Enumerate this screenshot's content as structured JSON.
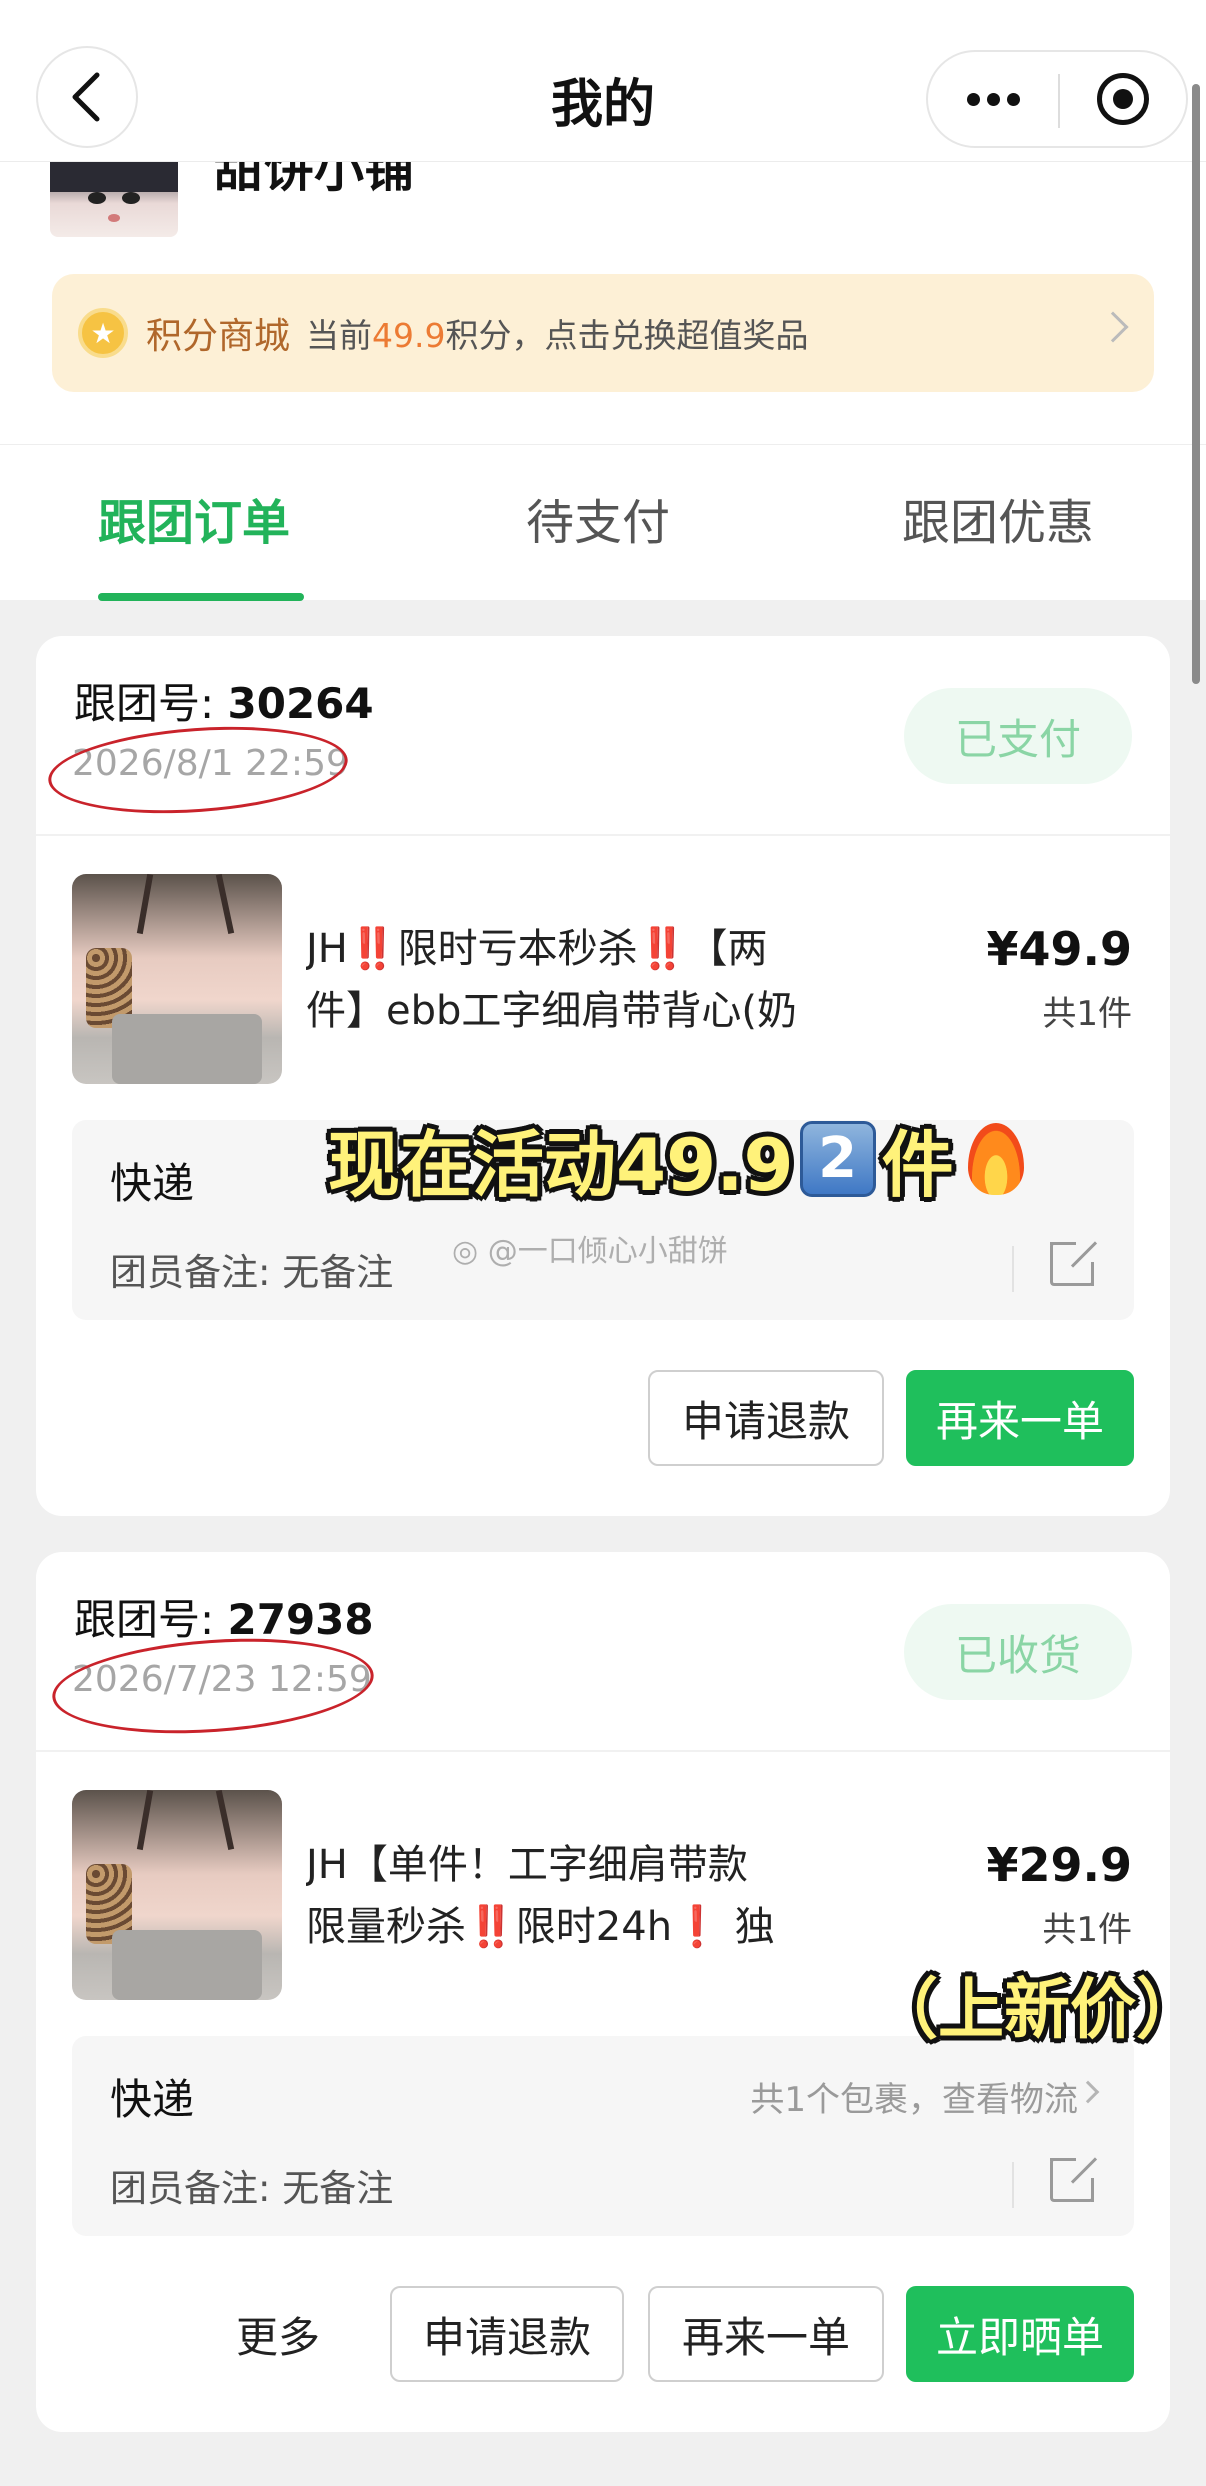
{
  "header": {
    "title": "我的"
  },
  "profile": {
    "shop_name": "甜饼小铺"
  },
  "points_banner": {
    "title": "积分商城",
    "desc_prefix": "当前",
    "points": "49.9",
    "desc_suffix": "积分，点击兑换超值奖品"
  },
  "tabs": [
    {
      "label": "跟团订单",
      "active": true
    },
    {
      "label": "待支付",
      "active": false
    },
    {
      "label": "跟团优惠",
      "active": false
    }
  ],
  "orders": [
    {
      "order_label": "跟团号: ",
      "order_number": "30264",
      "time": "2026/8/1 22:59",
      "status": "已支付",
      "title_line1_prefix": "JH",
      "title_line1_mark1": "‼️",
      "title_line1_mid": "限时亏本秒杀",
      "title_line1_mark2": "‼️",
      "title_line1_suffix": "【两",
      "title_line2": "件】ebb工字细肩带背心(奶",
      "price": "¥49.9",
      "quantity": "共1件",
      "delivery_label": "快递",
      "remark": "团员备注: 无备注",
      "buttons": {
        "refund": "申请退款",
        "reorder": "再来一单"
      }
    },
    {
      "order_label": "跟团号: ",
      "order_number": "27938",
      "time": "2026/7/23 12:59",
      "status": "已收货",
      "title_line1": "JH【单件！工字细肩带款",
      "title_line2_prefix": "限量秒杀",
      "title_line2_mark1": "‼️",
      "title_line2_mid": "限时24h",
      "title_line2_mark2": "❗",
      "title_line2_suffix": " 独",
      "price": "¥29.9",
      "quantity": "共1件",
      "delivery_label": "快递",
      "delivery_link": "共1个包裹，查看物流",
      "remark": "团员备注: 无备注",
      "buttons": {
        "more": "更多",
        "refund": "申请退款",
        "reorder": "再来一单",
        "review": "立即晒单"
      }
    }
  ],
  "overlays": {
    "promo_prefix": "现在活动49.9",
    "promo_key": "2",
    "promo_suffix": "件",
    "watermark": "@一口倾心小甜饼",
    "new_price": "（上新价）"
  },
  "colors": {
    "brand_green": "#1fbf5c",
    "tab_green": "#22b35a",
    "points_orange": "#ec7b34",
    "banner_bg": "#fdf0d6"
  },
  "icons": [
    "back-icon",
    "more-dots-icon",
    "record-target-icon",
    "coin-star-icon",
    "chevron-right-icon",
    "edit-icon",
    "weibo-icon",
    "fire-icon"
  ]
}
